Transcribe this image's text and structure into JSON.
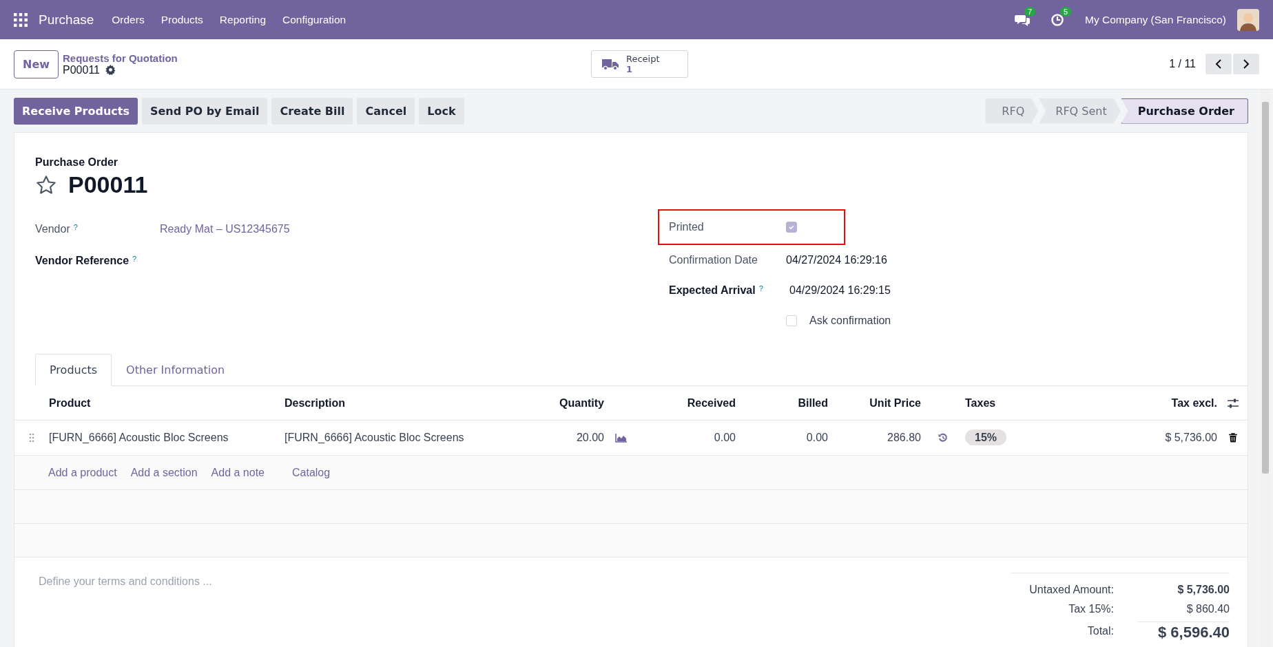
{
  "navbar": {
    "app_name": "Purchase",
    "menu": [
      "Orders",
      "Products",
      "Reporting",
      "Configuration"
    ],
    "messages_count": "7",
    "activities_count": "5",
    "company": "My Company (San Francisco)"
  },
  "control_panel": {
    "new_button": "New",
    "breadcrumb": "Requests for Quotation",
    "record": "P00011",
    "smart_button": {
      "label": "Receipt",
      "count": "1"
    },
    "pager": "1 / 11"
  },
  "actions": [
    {
      "label": "Receive Products",
      "kind": "primary"
    },
    {
      "label": "Send PO by Email",
      "kind": "secondary"
    },
    {
      "label": "Create Bill",
      "kind": "secondary"
    },
    {
      "label": "Cancel",
      "kind": "secondary"
    },
    {
      "label": "Lock",
      "kind": "secondary"
    }
  ],
  "status_bar": [
    {
      "label": "RFQ",
      "selected": false
    },
    {
      "label": "RFQ Sent",
      "selected": false
    },
    {
      "label": "Purchase Order",
      "selected": true
    }
  ],
  "form": {
    "subtitle": "Purchase Order",
    "name": "P00011",
    "starred": false,
    "left_fields": [
      {
        "label": "Vendor",
        "help": "?",
        "required": false,
        "value": "Ready Mat – US12345675"
      },
      {
        "label": "Vendor Reference",
        "help": "?",
        "required": true
      }
    ],
    "right_fields": [
      {
        "kind": "checkbox",
        "label": "Printed",
        "checked": true,
        "highlighted": true,
        "required": false
      },
      {
        "kind": "text",
        "label": "Confirmation Date",
        "value": "04/27/2024 16:29:16",
        "required": false
      },
      {
        "kind": "text",
        "label": "Expected Arrival",
        "help": "?",
        "value": "04/29/2024 16:29:15",
        "required": true
      },
      {
        "kind": "option",
        "label": "Ask confirmation",
        "checked": false
      }
    ]
  },
  "tabs": [
    {
      "label": "Products",
      "selected": true
    },
    {
      "label": "Other Information",
      "selected": false
    }
  ],
  "table": {
    "columns": [
      "Product",
      "Description",
      "Quantity",
      "Received",
      "Billed",
      "Unit Price",
      "Taxes",
      "Tax excl."
    ],
    "rows": [
      {
        "product": "[FURN_6666] Acoustic Bloc Screens",
        "description": "[FURN_6666] Acoustic Bloc Screens",
        "quantity": "20.00",
        "received": "0.00",
        "billed": "0.00",
        "unit_price": "286.80",
        "taxes": "15%",
        "tax_excl": "$ 5,736.00"
      }
    ],
    "add_links": [
      "Add a product",
      "Add a section",
      "Add a note",
      "Catalog"
    ]
  },
  "terms": {
    "placeholder": "Define your terms and conditions ..."
  },
  "totals": [
    {
      "label": "Untaxed Amount:",
      "value": "$ 5,736.00",
      "kind": "subtotal"
    },
    {
      "label": "Tax 15%:",
      "value": "$ 860.40",
      "kind": "tax"
    },
    {
      "label": "Total:",
      "value": "$ 6,596.40",
      "kind": "total"
    }
  ]
}
